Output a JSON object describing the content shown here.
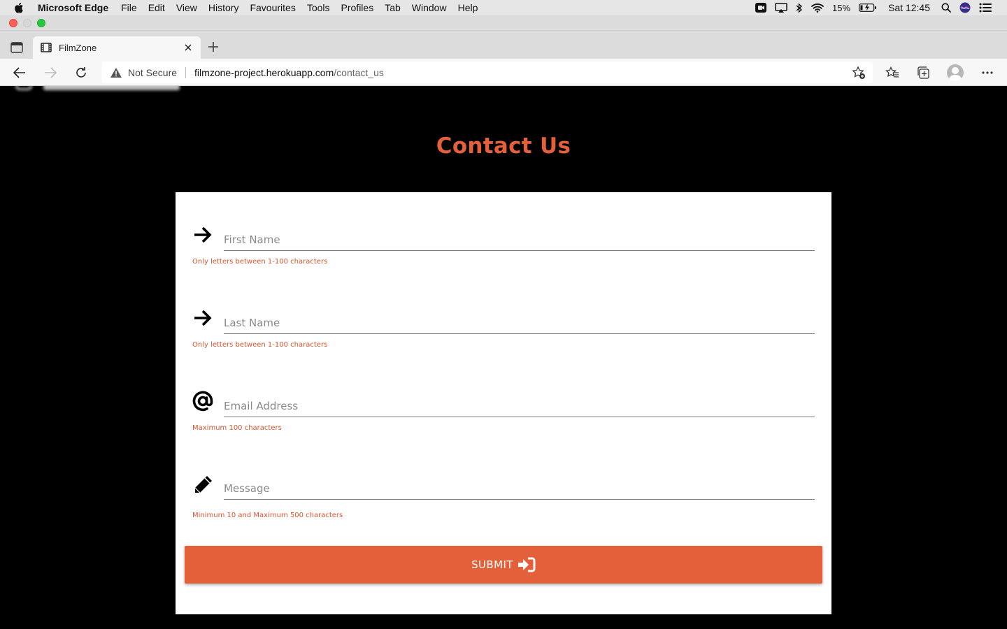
{
  "menubar": {
    "app_name": "Microsoft Edge",
    "items": [
      "File",
      "Edit",
      "View",
      "History",
      "Favourites",
      "Tools",
      "Profiles",
      "Tab",
      "Window",
      "Help"
    ],
    "battery": "15%",
    "clock": "Sat 12:45"
  },
  "browser": {
    "tab_title": "FilmZone",
    "security_label": "Not Secure",
    "url_host": "filmzone-project.herokuapp.com",
    "url_path": "/contact_us"
  },
  "page": {
    "heading": "Contact Us",
    "accent_color": "#e4603a",
    "fields": [
      {
        "icon": "arrow-right-icon",
        "placeholder": "First Name",
        "value": "",
        "helper": "Only letters between 1-100 characters"
      },
      {
        "icon": "arrow-right-icon",
        "placeholder": "Last Name",
        "value": "",
        "helper": "Only letters between 1-100 characters"
      },
      {
        "icon": "at-sign-icon",
        "placeholder": "Email Address",
        "value": "",
        "helper": "Maximum 100 characters"
      },
      {
        "icon": "pencil-icon",
        "placeholder": "Message",
        "value": "",
        "helper": "Minimum 10 and Maximum 500 characters"
      }
    ],
    "submit_label": "SUBMIT"
  }
}
